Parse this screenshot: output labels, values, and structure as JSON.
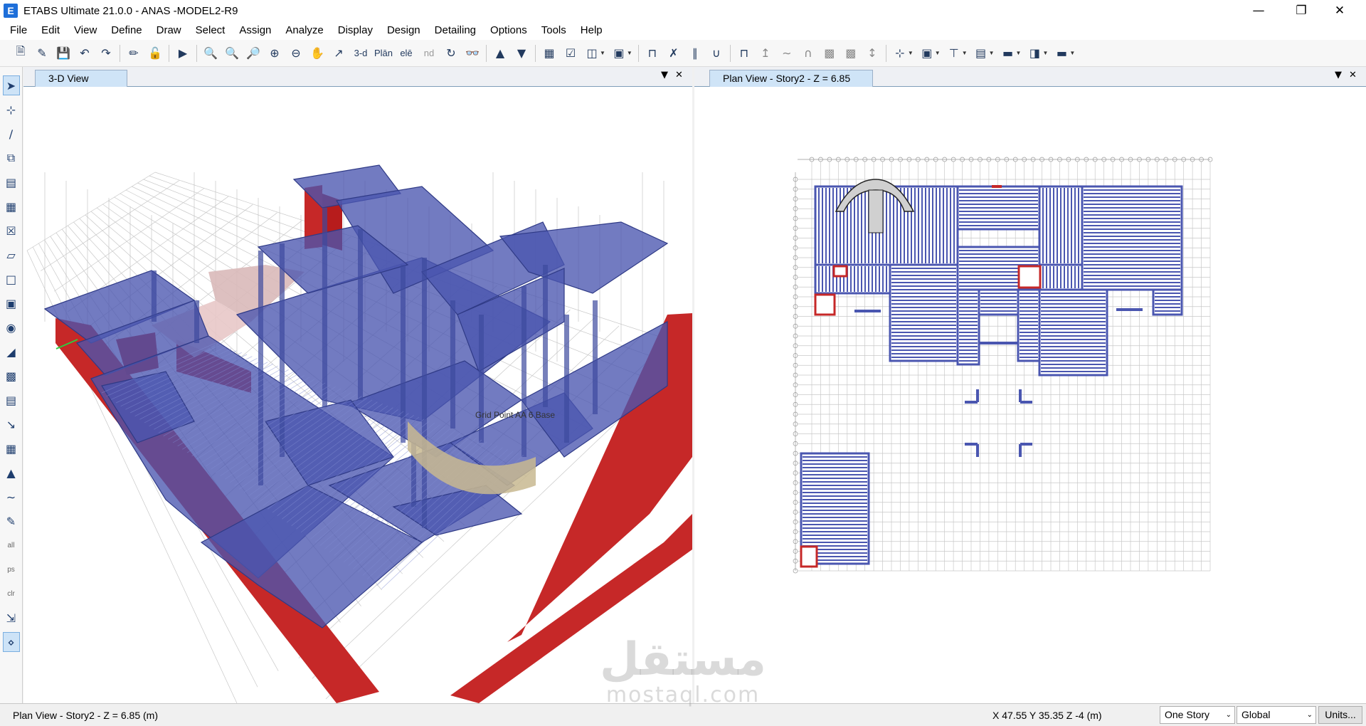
{
  "window": {
    "title": "ETABS Ultimate 21.0.0 - ANAS -MODEL2-R9",
    "icon_letter": "E"
  },
  "menu": [
    "File",
    "Edit",
    "View",
    "Define",
    "Draw",
    "Select",
    "Assign",
    "Analyze",
    "Display",
    "Design",
    "Detailing",
    "Options",
    "Tools",
    "Help"
  ],
  "toolbar": {
    "label_3d": "3-d",
    "label_plan": "Plān",
    "label_elev": "elē",
    "label_nd": "nd"
  },
  "left_panel": {
    "tab_label": "3-D View",
    "annotation": "Grid Point  AA  6  Base"
  },
  "right_panel": {
    "tab_label": "Plan View - Story2 - Z = 6.85 (m)"
  },
  "status": {
    "left_text": "Plan View - Story2 - Z = 6.85 (m)",
    "coords": "X 47.55  Y 35.35  Z -4 (m)",
    "story_combo": "One Story",
    "coord_combo": "Global",
    "units_button": "Units..."
  },
  "watermark": {
    "arabic": "مستقل",
    "latin": "mostaql.com"
  },
  "colors": {
    "slab": "#4a56b0",
    "wall": "#c62828",
    "grid": "#c8c8c8",
    "tab_active": "#cfe4f7"
  }
}
